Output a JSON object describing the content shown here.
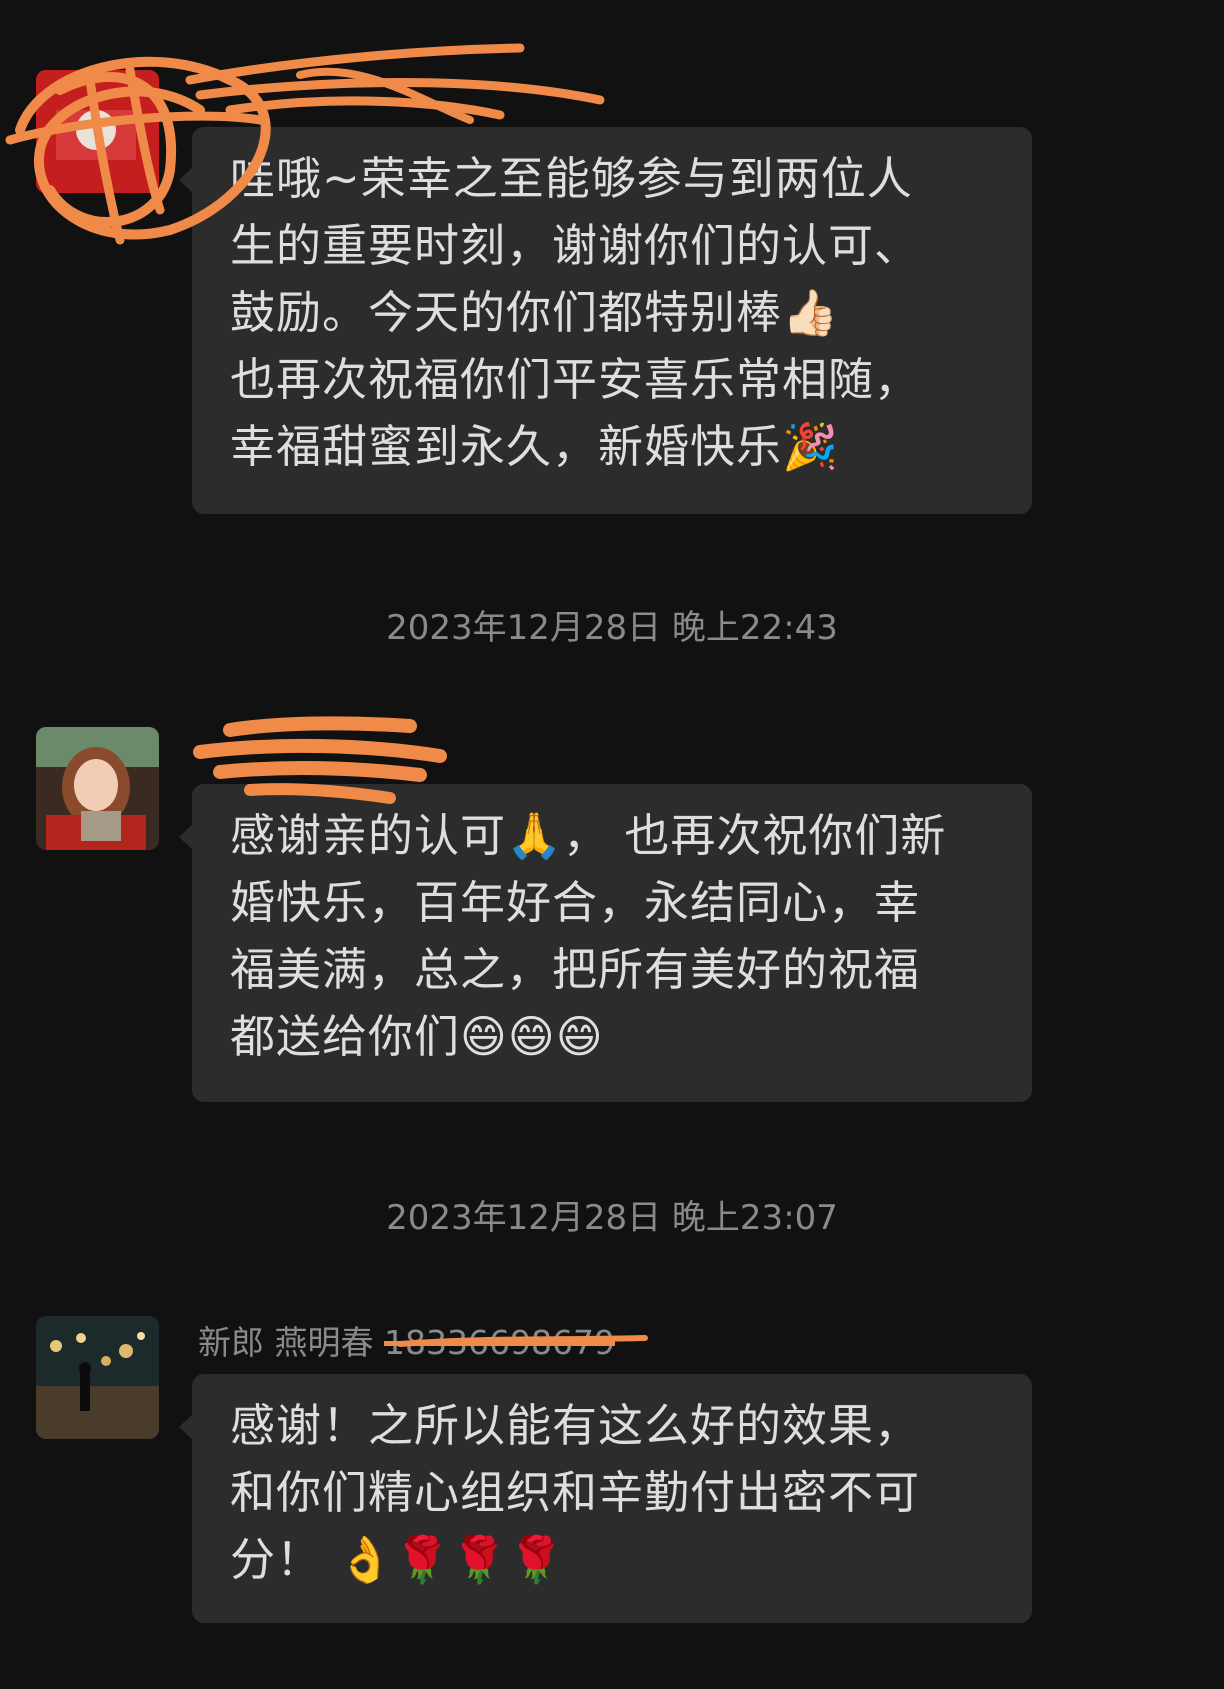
{
  "messages": [
    {
      "sender": "",
      "lines": [
        "哇哦~荣幸之至能够参与到两位人",
        "生的重要时刻，谢谢你们的认可、",
        "鼓励。今天的你们都特别棒👍🏻",
        "也再次祝福你们平安喜乐常相随，",
        "幸福甜蜜到永久，新婚快乐🎉"
      ]
    },
    {
      "sender": "",
      "lines": [
        "感谢亲的认可🙏， 也再次祝你们新",
        "婚快乐，百年好合，永结同心，幸",
        "福美满，总之，把所有美好的祝福",
        "都送给你们😄😄😄"
      ]
    },
    {
      "sender_name": "新郎 燕明春",
      "sender_phone": "18336698679",
      "lines": [
        "感谢！之所以能有这么好的效果，",
        "和你们精心组织和辛勤付出密不可",
        "分！ 👌🌹🌹🌹"
      ]
    }
  ],
  "timestamps": [
    "2023年12月28日 晚上22:43",
    "2023年12月28日 晚上23:07"
  ],
  "colors": {
    "background": "#111111",
    "bubble": "#2c2c2c",
    "text": "#dedede",
    "meta": "#8a8a8a",
    "redaction": "#f08a48"
  }
}
